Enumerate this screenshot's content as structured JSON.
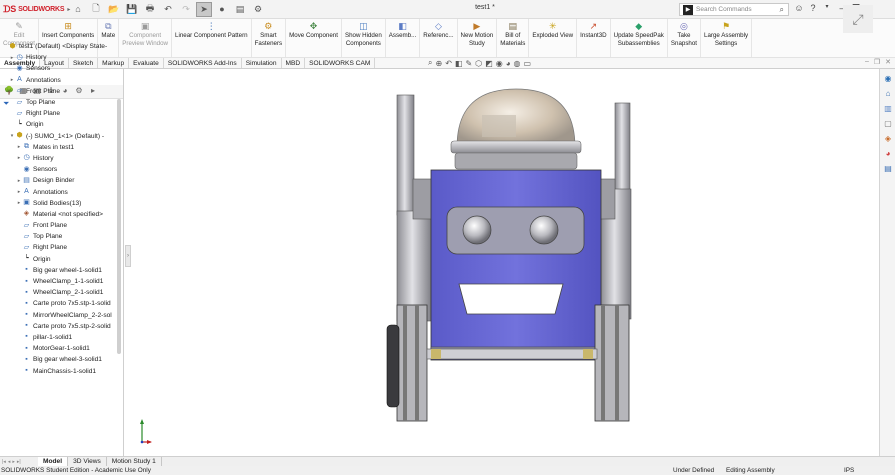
{
  "app": {
    "logo_text": "SOLIDWORKS",
    "doc_title": "test1 *",
    "search_placeholder": "Search Commands"
  },
  "ribbon": {
    "buttons": [
      {
        "label": "Edit\nComponent",
        "icon": "edit-component-icon",
        "disabled": true
      },
      {
        "label": "Insert Components",
        "icon": "insert-components-icon",
        "disabled": false
      },
      {
        "label": "Mate",
        "icon": "mate-icon",
        "disabled": false
      },
      {
        "label": "Component\nPreview Window",
        "icon": "component-preview-icon",
        "disabled": true
      },
      {
        "label": "Linear Component Pattern",
        "icon": "linear-pattern-icon",
        "disabled": false
      },
      {
        "label": "Smart\nFasteners",
        "icon": "smart-fasteners-icon",
        "disabled": false
      },
      {
        "label": "Move Component",
        "icon": "move-component-icon",
        "disabled": false
      },
      {
        "label": "Show Hidden\nComponents",
        "icon": "show-hidden-icon",
        "disabled": false
      },
      {
        "label": "Assemb...",
        "icon": "assembly-features-icon",
        "disabled": false
      },
      {
        "label": "Referenc...",
        "icon": "reference-geometry-icon",
        "disabled": false
      },
      {
        "label": "New Motion\nStudy",
        "icon": "motion-study-icon",
        "disabled": false
      },
      {
        "label": "Bill of\nMaterials",
        "icon": "bom-icon",
        "disabled": false
      },
      {
        "label": "Exploded View",
        "icon": "exploded-view-icon",
        "disabled": false
      },
      {
        "label": "Instant3D",
        "icon": "instant3d-icon",
        "disabled": false
      },
      {
        "label": "Update SpeedPak\nSubassemblies",
        "icon": "speedpak-icon",
        "disabled": false
      },
      {
        "label": "Take\nSnapshot",
        "icon": "snapshot-icon",
        "disabled": false
      },
      {
        "label": "Large Assembly\nSettings",
        "icon": "large-assembly-icon",
        "disabled": false
      }
    ]
  },
  "cm_tabs": [
    "Assembly",
    "Layout",
    "Sketch",
    "Markup",
    "Evaluate",
    "SOLIDWORKS Add-Ins",
    "Simulation",
    "MBD",
    "SOLIDWORKS CAM"
  ],
  "tree": [
    {
      "label": "test1 (Default) <Display State-",
      "level": 0,
      "arrow": "",
      "icon": "assembly-icon"
    },
    {
      "label": "History",
      "level": 1,
      "arrow": "▸",
      "icon": "history-icon"
    },
    {
      "label": "Sensors",
      "level": 1,
      "arrow": "",
      "icon": "sensors-icon"
    },
    {
      "label": "Annotations",
      "level": 1,
      "arrow": "▸",
      "icon": "annotations-icon"
    },
    {
      "label": "Front Plane",
      "level": 1,
      "arrow": "",
      "icon": "plane-icon"
    },
    {
      "label": "Top Plane",
      "level": 1,
      "arrow": "",
      "icon": "plane-icon"
    },
    {
      "label": "Right Plane",
      "level": 1,
      "arrow": "",
      "icon": "plane-icon"
    },
    {
      "label": "Origin",
      "level": 1,
      "arrow": "",
      "icon": "origin-icon"
    },
    {
      "label": "(-) SUMO_1<1> (Default) -",
      "level": 1,
      "arrow": "▾",
      "icon": "subassembly-icon"
    },
    {
      "label": "Mates in test1",
      "level": 2,
      "arrow": "▸",
      "icon": "mates-icon"
    },
    {
      "label": "History",
      "level": 2,
      "arrow": "▸",
      "icon": "history-icon"
    },
    {
      "label": "Sensors",
      "level": 2,
      "arrow": "",
      "icon": "sensors-icon"
    },
    {
      "label": "Design Binder",
      "level": 2,
      "arrow": "▸",
      "icon": "design-binder-icon"
    },
    {
      "label": "Annotations",
      "level": 2,
      "arrow": "▸",
      "icon": "annotations-icon"
    },
    {
      "label": "Solid Bodies(13)",
      "level": 2,
      "arrow": "▸",
      "icon": "solid-bodies-icon"
    },
    {
      "label": "Material <not specified>",
      "level": 2,
      "arrow": "",
      "icon": "material-icon"
    },
    {
      "label": "Front Plane",
      "level": 2,
      "arrow": "",
      "icon": "plane-icon"
    },
    {
      "label": "Top Plane",
      "level": 2,
      "arrow": "",
      "icon": "plane-icon"
    },
    {
      "label": "Right Plane",
      "level": 2,
      "arrow": "",
      "icon": "plane-icon"
    },
    {
      "label": "Origin",
      "level": 2,
      "arrow": "",
      "icon": "origin-icon"
    },
    {
      "label": "Big gear wheel-1-solid1",
      "level": 2,
      "arrow": "",
      "icon": "body-icon"
    },
    {
      "label": "WheelClamp_1-1-solid1",
      "level": 2,
      "arrow": "",
      "icon": "body-icon"
    },
    {
      "label": "WheelClamp_2-1-solid1",
      "level": 2,
      "arrow": "",
      "icon": "body-icon"
    },
    {
      "label": "Carte proto 7x5.stp-1-solid",
      "level": 2,
      "arrow": "",
      "icon": "body-icon"
    },
    {
      "label": "MirrorWheelClamp_2-2-sol",
      "level": 2,
      "arrow": "",
      "icon": "body-icon"
    },
    {
      "label": "Carte proto 7x5.stp-2-solid",
      "level": 2,
      "arrow": "",
      "icon": "body-icon"
    },
    {
      "label": "pillar-1-solid1",
      "level": 2,
      "arrow": "",
      "icon": "body-icon"
    },
    {
      "label": "MotorGear-1-solid1",
      "level": 2,
      "arrow": "",
      "icon": "body-icon"
    },
    {
      "label": "Big gear wheel-3-solid1",
      "level": 2,
      "arrow": "",
      "icon": "body-icon"
    },
    {
      "label": "MainChassis-1-solid1",
      "level": 2,
      "arrow": "",
      "icon": "body-icon"
    }
  ],
  "bottom_tabs": [
    "Model",
    "3D Views",
    "Motion Study 1"
  ],
  "status": {
    "left": "SOLIDWORKS Student Edition - Academic Use Only",
    "definition": "Under Defined",
    "mode": "Editing Assembly",
    "units": "IPS"
  },
  "colors": {
    "body_purple": "#6a6ad6",
    "metal_gray": "#b9b9bd",
    "logo_red": "#d0202a"
  }
}
